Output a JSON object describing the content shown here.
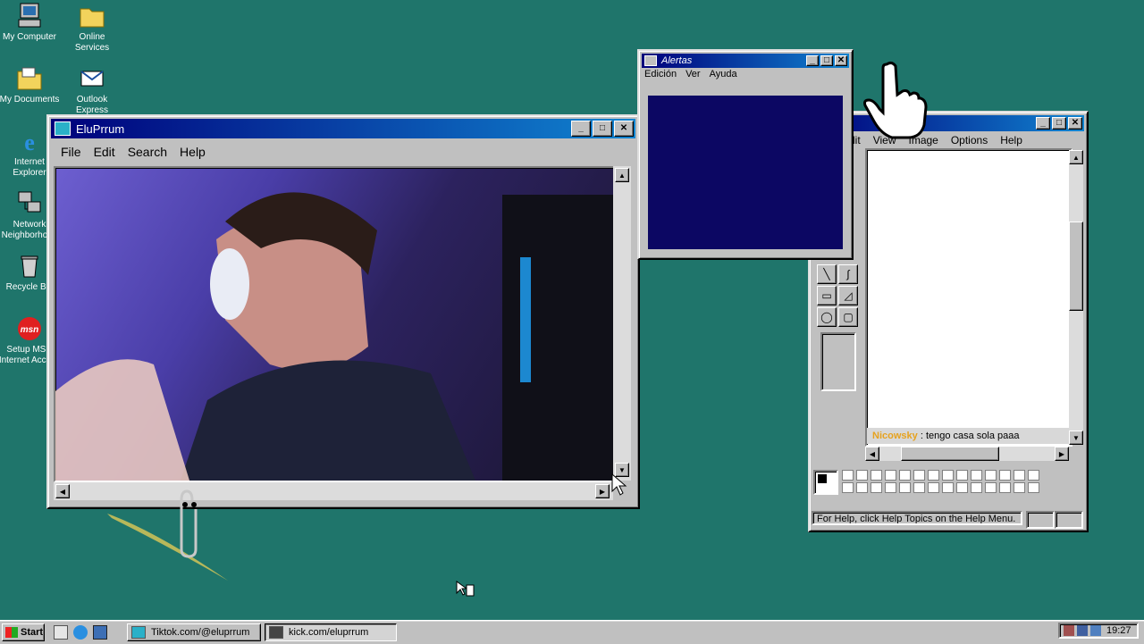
{
  "desktop_icons": [
    {
      "label": "My Computer",
      "icon": "computer-icon"
    },
    {
      "label": "Online Services",
      "icon": "folder-icon"
    },
    {
      "label": "My Documents",
      "icon": "folder-icon"
    },
    {
      "label": "Outlook Express",
      "icon": "outlook-icon"
    },
    {
      "label": "Internet Explorer",
      "icon": "ie-icon"
    },
    {
      "label": "Network Neighborhood",
      "icon": "network-icon"
    },
    {
      "label": "Recycle Bin",
      "icon": "recycle-bin-icon"
    },
    {
      "label": "Setup MSN Internet Access",
      "icon": "msn-icon"
    },
    {
      "logo_text": "msn"
    }
  ],
  "stream_window": {
    "title": "EluPrrum",
    "menu": [
      "File",
      "Edit",
      "Search",
      "Help"
    ]
  },
  "alerts_window": {
    "title": "Alertas",
    "menu": [
      "Edición",
      "Ver",
      "Ayuda"
    ],
    "panel_color": "#0c0763"
  },
  "paint_window": {
    "menu": [
      "dit",
      "View",
      "Image",
      "Options",
      "Help"
    ],
    "chat_user": "Nicowsky",
    "chat_separator": ":",
    "chat_message": "tengo casa sola paaa",
    "status_text": "For Help, click Help Topics on the Help Menu."
  },
  "taskbar": {
    "start_label": "Start",
    "tasks": [
      "Tiktok.com/@eluprrum",
      "kick.com/eluprrum"
    ],
    "clock": "19:27"
  },
  "colors": {
    "desktop": "#1f756b",
    "title_active": "#00007b",
    "chat_user": "#e6a21f"
  }
}
